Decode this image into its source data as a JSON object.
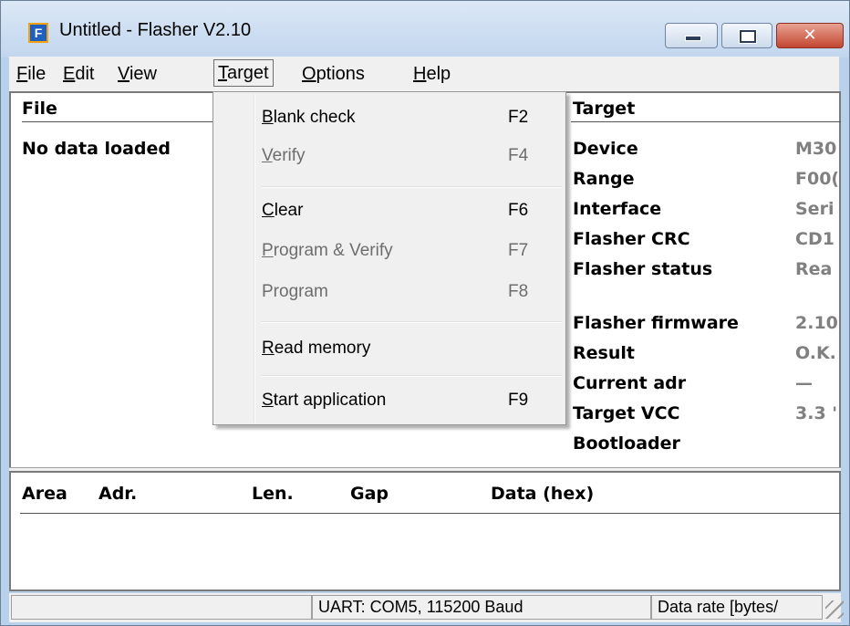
{
  "window": {
    "title": "Untitled - Flasher V2.10",
    "app_icon_letter": "F",
    "close_glyph": "✕"
  },
  "menubar": {
    "items": [
      {
        "u": "F",
        "rest": "ile"
      },
      {
        "u": "E",
        "rest": "dit"
      },
      {
        "u": "V",
        "rest": "iew"
      },
      {
        "u": "T",
        "rest": "arget"
      },
      {
        "u": "O",
        "rest": "ptions"
      },
      {
        "u": "H",
        "rest": "elp"
      }
    ]
  },
  "file_panel": {
    "header": "File",
    "status": "No data loaded"
  },
  "target_panel": {
    "header": "Target",
    "properties": [
      {
        "label": "Device",
        "value": "M30"
      },
      {
        "label": "Range",
        "value": "F00("
      },
      {
        "label": "Interface",
        "value": "Seri"
      },
      {
        "label": "Flasher CRC",
        "value": "CD1"
      },
      {
        "label": "Flasher status",
        "value": "Rea"
      },
      {
        "label": "Flasher firmware",
        "value": "2.10"
      },
      {
        "label": "Result",
        "value": "O.K."
      },
      {
        "label": "Current adr",
        "value": "—"
      },
      {
        "label": "Target VCC",
        "value": "3.3 '"
      },
      {
        "label": "Bootloader",
        "value": ""
      }
    ]
  },
  "data_grid": {
    "columns": [
      "Area",
      "Adr.",
      "Len.",
      "Gap",
      "Data (hex)"
    ]
  },
  "statusbar": {
    "cells": [
      "",
      "UART: COM5, 115200 Baud",
      "Data rate [bytes/"
    ]
  },
  "target_menu": {
    "items": [
      {
        "u": "B",
        "rest": "lank check",
        "key": "F2",
        "enabled": true
      },
      {
        "u": "V",
        "rest": "erify",
        "key": "F4",
        "enabled": false
      },
      {
        "u": "C",
        "rest": "lear",
        "key": "F6",
        "enabled": true
      },
      {
        "u": "P",
        "rest": "rogram & Verify",
        "key": "F7",
        "enabled": false
      },
      {
        "u": "",
        "rest": "Program",
        "key": "F8",
        "enabled": false
      },
      {
        "u": "R",
        "rest": "ead memory",
        "key": "",
        "enabled": true
      },
      {
        "u": "S",
        "rest": "tart application",
        "key": "F9",
        "enabled": true
      }
    ]
  },
  "colors": {
    "window_frame": "#b9d1ea",
    "menu_bg": "#f0f0f0",
    "disabled_text": "#6d6d6d",
    "value_text": "#808080"
  }
}
